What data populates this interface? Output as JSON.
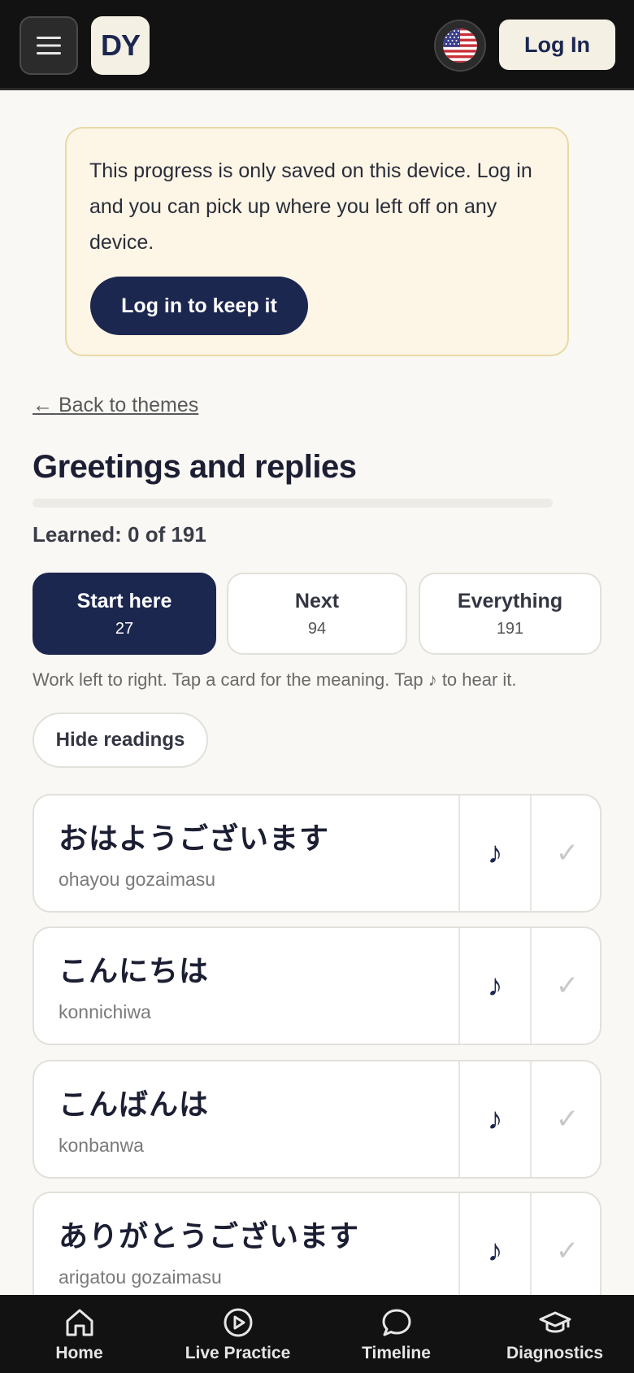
{
  "header": {
    "logo_text": "DY",
    "login_label": "Log In",
    "colors": {
      "bar": "#121212",
      "brand": "#1c2750",
      "cream": "#f4f0e4"
    }
  },
  "notice": {
    "text": "This progress is only saved on this device. Log in and you can pick up where you left off on any device.",
    "button_label": "Log in to keep it"
  },
  "back_link": "← Back to themes",
  "page_title": "Greetings and replies",
  "progress": {
    "learned_text": "Learned: 0 of 191",
    "fraction": 0
  },
  "tabs": [
    {
      "label": "Start here",
      "count": "27",
      "active": true
    },
    {
      "label": "Next",
      "count": "94",
      "active": false
    },
    {
      "label": "Everything",
      "count": "191",
      "active": false
    }
  ],
  "hint": "Work left to right. Tap a card for the meaning. Tap ♪ to hear it.",
  "hide_readings_label": "Hide readings",
  "cards": [
    {
      "japanese": "おはようございます",
      "romaji": "ohayou gozaimasu"
    },
    {
      "japanese": "こんにちは",
      "romaji": "konnichiwa"
    },
    {
      "japanese": "こんばんは",
      "romaji": "konbanwa"
    },
    {
      "japanese": "ありがとうございます",
      "romaji": "arigatou gozaimasu"
    }
  ],
  "card_icons": {
    "audio": "♪",
    "check": "✓"
  },
  "nav": [
    {
      "label": "Home",
      "icon": "home-icon"
    },
    {
      "label": "Live Practice",
      "icon": "play-circle-icon"
    },
    {
      "label": "Timeline",
      "icon": "chat-bubble-icon"
    },
    {
      "label": "Diagnostics",
      "icon": "graduation-cap-icon"
    }
  ]
}
